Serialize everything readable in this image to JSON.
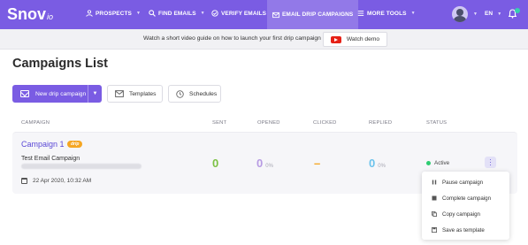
{
  "nav": {
    "logo_main": "Snov",
    "logo_suffix": "io",
    "items": [
      {
        "label": "PROSPECTS",
        "icon": "person-icon"
      },
      {
        "label": "FIND EMAILS",
        "icon": "search-icon"
      },
      {
        "label": "VERIFY EMAILS",
        "icon": "check-circle-icon"
      },
      {
        "label": "EMAIL DRIP CAMPAIGNS",
        "icon": "mail-icon"
      },
      {
        "label": "MORE TOOLS",
        "icon": "menu-icon"
      }
    ],
    "language": "EN",
    "accent": "#7a5ce3"
  },
  "banner": {
    "text": "Watch a short video guide on how to launch your first drip campaign",
    "button_label": "Watch demo"
  },
  "page": {
    "title": "Campaigns List"
  },
  "toolbar": {
    "new_campaign_label": "New drip campaign",
    "templates_label": "Templates",
    "schedules_label": "Schedules"
  },
  "table": {
    "headers": [
      "CAMPAIGN",
      "SENT",
      "OPENED",
      "CLICKED",
      "REPLIED",
      "STATUS"
    ],
    "rows": [
      {
        "name": "Campaign 1",
        "tag": "drip",
        "subtitle": "Test Email Campaign",
        "date": "22 Apr 2020, 10:32 AM",
        "sent": "0",
        "opened": "0",
        "opened_pct": "0%",
        "clicked": "–",
        "replied": "0",
        "replied_pct": "0%",
        "status": "Active"
      }
    ]
  },
  "menu": {
    "items": [
      {
        "label": "Pause campaign",
        "icon": "pause-icon"
      },
      {
        "label": "Complete campaign",
        "icon": "stop-icon"
      },
      {
        "label": "Copy campaign",
        "icon": "copy-icon"
      },
      {
        "label": "Save as template",
        "icon": "save-icon"
      }
    ]
  },
  "colors": {
    "sent": "#7cc144",
    "opened": "#b79be3",
    "clicked": "#f5a623",
    "replied": "#6cc3ec",
    "active": "#2ecc71"
  }
}
